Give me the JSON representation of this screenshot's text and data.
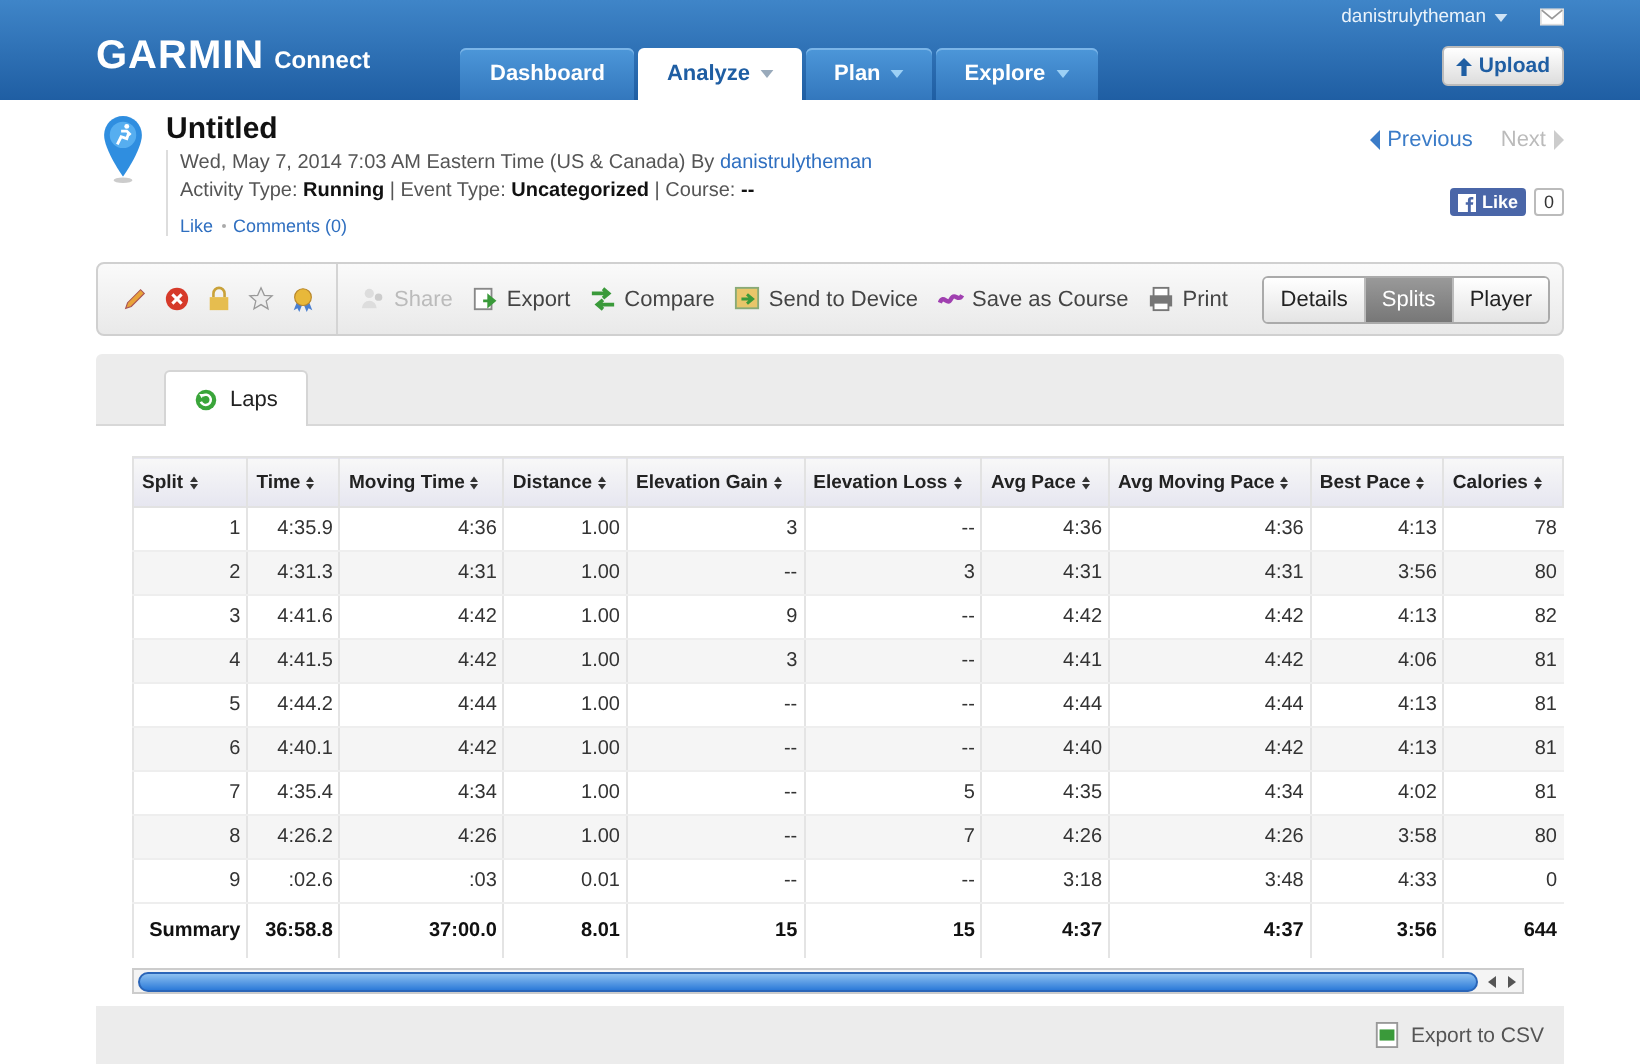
{
  "header": {
    "logo": "GARMIN",
    "logo_suffix": "Connect",
    "user": "danistrulytheman",
    "upload": "Upload",
    "nav_tabs": [
      {
        "label": "Dashboard",
        "selected": false,
        "dropdown": false
      },
      {
        "label": "Analyze",
        "selected": true,
        "dropdown": true
      },
      {
        "label": "Plan",
        "selected": false,
        "dropdown": true
      },
      {
        "label": "Explore",
        "selected": false,
        "dropdown": true
      }
    ]
  },
  "activity": {
    "title": "Untitled",
    "date_line": "Wed, May 7, 2014 7:03 AM Eastern Time (US & Canada) By",
    "author": "danistrulytheman",
    "details": "Activity Type: **Running** | Event Type: **Uncategorized** | Course: **--**",
    "like": "Like",
    "comments": "Comments (0)"
  },
  "pager": {
    "previous": "Previous",
    "next": "Next",
    "next_disabled": true
  },
  "facebook": {
    "label": "Like",
    "count": "0"
  },
  "toolbar": {
    "tools": [
      {
        "kind": "edit"
      },
      {
        "kind": "delete"
      },
      {
        "kind": "lock"
      },
      {
        "kind": "favorite"
      },
      {
        "kind": "award"
      }
    ],
    "actions": [
      {
        "kind": "share",
        "label": "Share",
        "disabled": true
      },
      {
        "kind": "export",
        "label": "Export",
        "disabled": false
      },
      {
        "kind": "compare",
        "label": "Compare",
        "disabled": false
      },
      {
        "kind": "device",
        "label": "Send to Device",
        "disabled": false
      },
      {
        "kind": "course",
        "label": "Save as Course",
        "disabled": false
      },
      {
        "kind": "print",
        "label": "Print",
        "disabled": false
      }
    ],
    "views": [
      {
        "label": "Details",
        "selected": false
      },
      {
        "label": "Splits",
        "selected": true
      },
      {
        "label": "Player",
        "selected": false
      }
    ]
  },
  "tabs": [
    {
      "label": "Laps",
      "selected": true
    }
  ],
  "table": {
    "columns": [
      "Split",
      "Time",
      "Moving Time",
      "Distance",
      "Elevation Gain",
      "Elevation Loss",
      "Avg Pace",
      "Avg Moving Pace",
      "Best Pace",
      "Calories"
    ],
    "rows": [
      [
        "1",
        "4:35.9",
        "4:36",
        "1.00",
        "3",
        "--",
        "4:36",
        "4:36",
        "4:13",
        "78"
      ],
      [
        "2",
        "4:31.3",
        "4:31",
        "1.00",
        "--",
        "3",
        "4:31",
        "4:31",
        "3:56",
        "80"
      ],
      [
        "3",
        "4:41.6",
        "4:42",
        "1.00",
        "9",
        "--",
        "4:42",
        "4:42",
        "4:13",
        "82"
      ],
      [
        "4",
        "4:41.5",
        "4:42",
        "1.00",
        "3",
        "--",
        "4:41",
        "4:42",
        "4:06",
        "81"
      ],
      [
        "5",
        "4:44.2",
        "4:44",
        "1.00",
        "--",
        "--",
        "4:44",
        "4:44",
        "4:13",
        "81"
      ],
      [
        "6",
        "4:40.1",
        "4:42",
        "1.00",
        "--",
        "--",
        "4:40",
        "4:42",
        "4:13",
        "81"
      ],
      [
        "7",
        "4:35.4",
        "4:34",
        "1.00",
        "--",
        "5",
        "4:35",
        "4:34",
        "4:02",
        "81"
      ],
      [
        "8",
        "4:26.2",
        "4:26",
        "1.00",
        "--",
        "7",
        "4:26",
        "4:26",
        "3:58",
        "80"
      ],
      [
        "9",
        ":02.6",
        ":03",
        "0.01",
        "--",
        "--",
        "3:18",
        "3:48",
        "4:33",
        "0"
      ]
    ],
    "summary": [
      "Summary",
      "36:58.8",
      "37:00.0",
      "8.01",
      "15",
      "15",
      "4:37",
      "4:37",
      "3:56",
      "644"
    ]
  },
  "export": "Export to CSV"
}
